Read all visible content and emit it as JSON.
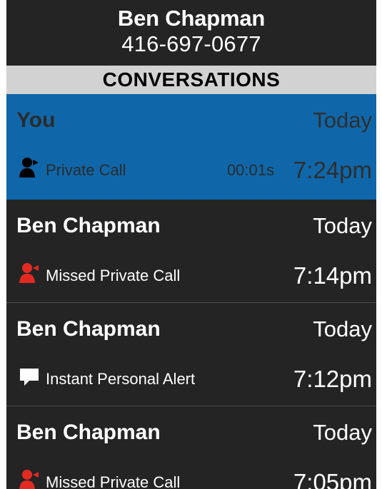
{
  "header": {
    "contact_name": "Ben Chapman",
    "contact_number": "416-697-0677"
  },
  "section": {
    "title": "CONVERSATIONS"
  },
  "conversations": [
    {
      "name": "You",
      "date": "Today",
      "type": "Private Call",
      "duration": "00:01s",
      "time": "7:24pm",
      "icon": "outgoing-private-call-icon",
      "selected": true
    },
    {
      "name": "Ben Chapman",
      "date": "Today",
      "type": "Missed Private Call",
      "duration": "",
      "time": "7:14pm",
      "icon": "missed-private-call-icon",
      "selected": false
    },
    {
      "name": "Ben Chapman",
      "date": "Today",
      "type": "Instant Personal Alert",
      "duration": "",
      "time": "7:12pm",
      "icon": "instant-personal-alert-icon",
      "selected": false
    },
    {
      "name": "Ben Chapman",
      "date": "Today",
      "type": "Missed Private Call",
      "duration": "",
      "time": "7:05pm",
      "icon": "missed-private-call-icon",
      "selected": false
    }
  ],
  "colors": {
    "background": "#242424",
    "selected": "#0f67aa",
    "section_bar": "#d2d2d2",
    "missed": "#e32a22",
    "text": "#ffffff"
  }
}
